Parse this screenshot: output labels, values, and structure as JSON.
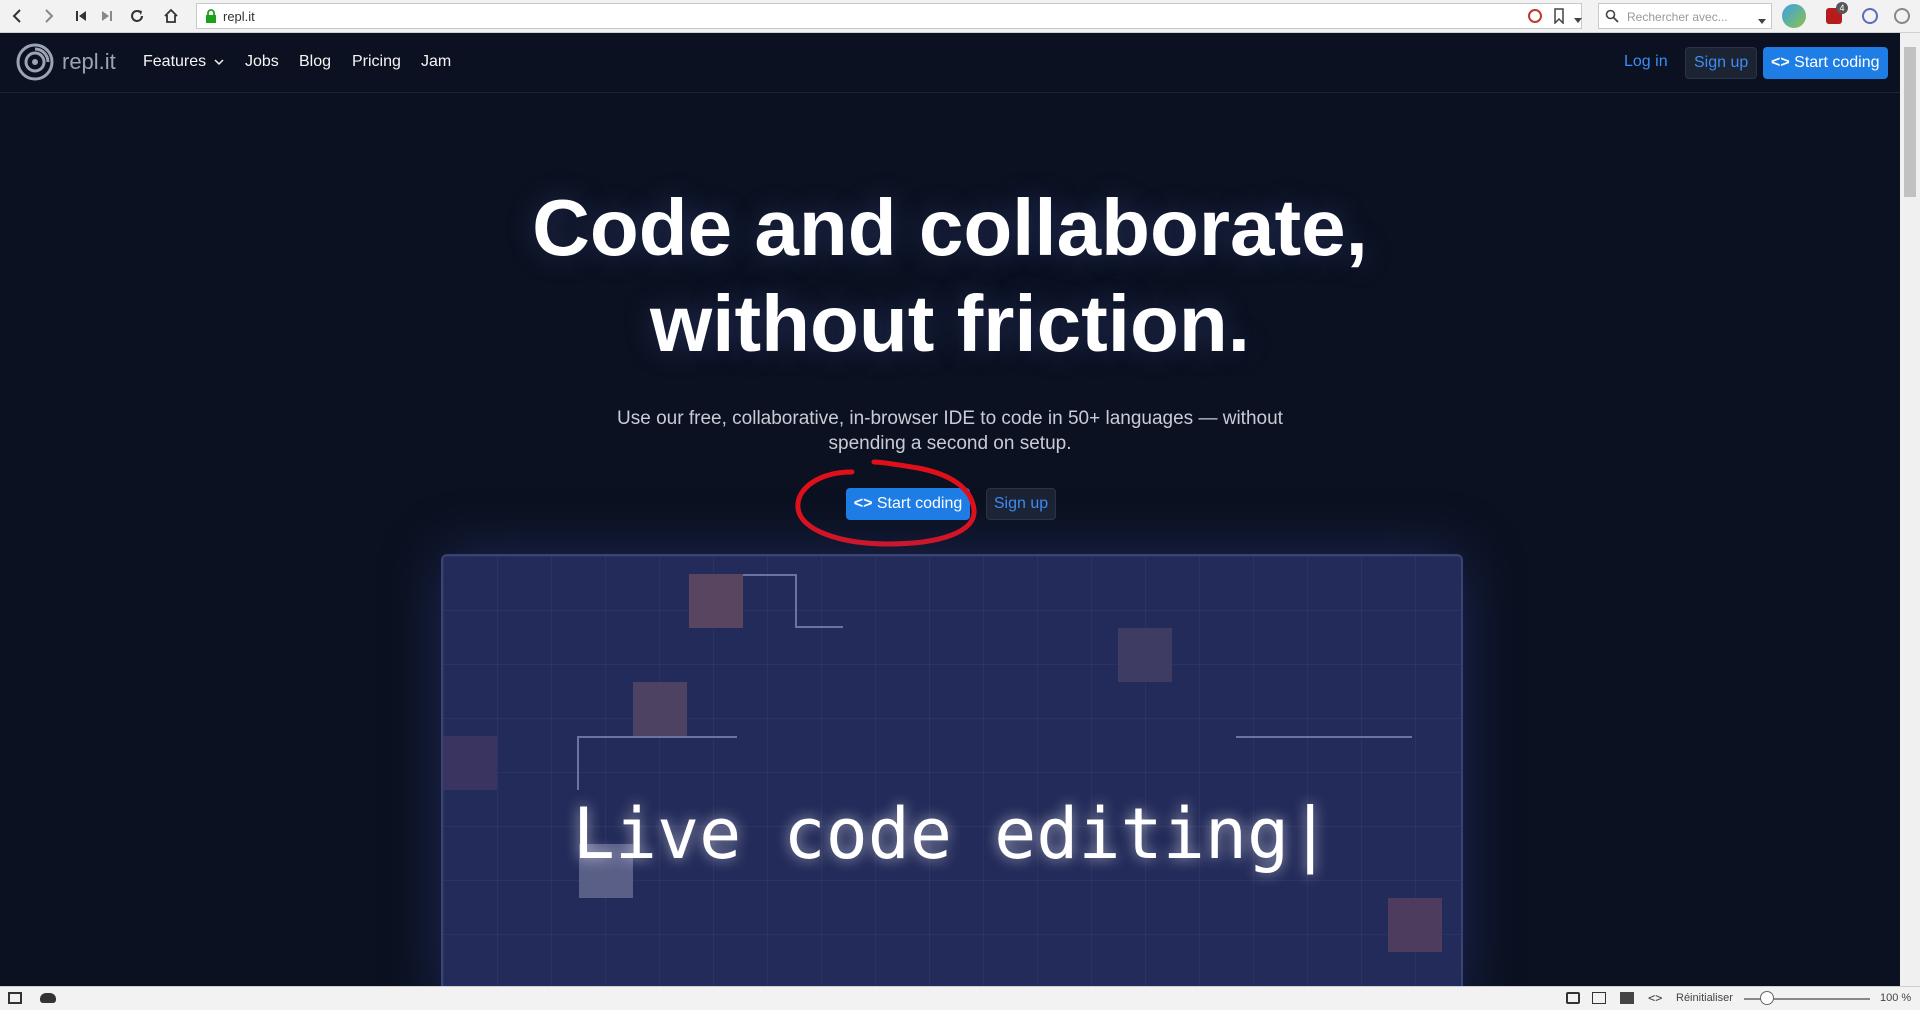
{
  "browser": {
    "url": "repl.it",
    "search_placeholder": "Rechercher avec...",
    "notification_count": "4",
    "status_reset_label": "Réinitialiser",
    "zoom_level": "100 %",
    "zoom_fraction": 0.5
  },
  "nav": {
    "logo_text": "repl.it",
    "links": [
      "Features",
      "Jobs",
      "Blog",
      "Pricing",
      "Jam"
    ],
    "login": "Log in",
    "signup": "Sign up",
    "start_coding": "Start coding"
  },
  "hero": {
    "title_line1": "Code and collaborate,",
    "title_line2": "without friction.",
    "subtitle": "Use our free, collaborative, in-browser IDE to code in 50+ languages — without spending a second on setup.",
    "start_coding": "Start coding",
    "signup": "Sign up"
  },
  "demo": {
    "caption": "Live code editing|"
  },
  "colors": {
    "background": "#0b1120",
    "accent_blue": "#1e7ee6",
    "link_blue": "#3d8cf5",
    "annotation_red": "#e0101a",
    "panel": "#232b5a"
  }
}
